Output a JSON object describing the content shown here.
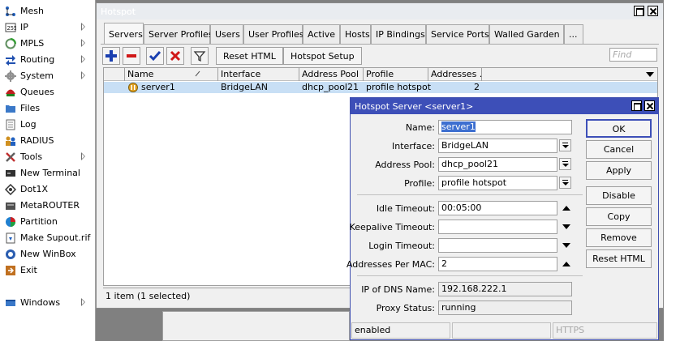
{
  "sidebar": {
    "items": [
      {
        "label": "Mesh",
        "icon": "mesh-icon",
        "submenu": false
      },
      {
        "label": "IP",
        "icon": "ip-icon",
        "submenu": true
      },
      {
        "label": "MPLS",
        "icon": "mpls-icon",
        "submenu": true
      },
      {
        "label": "Routing",
        "icon": "routing-icon",
        "submenu": true
      },
      {
        "label": "System",
        "icon": "system-gear-icon",
        "submenu": true
      },
      {
        "label": "Queues",
        "icon": "queues-icon",
        "submenu": false
      },
      {
        "label": "Files",
        "icon": "folder-icon",
        "submenu": false
      },
      {
        "label": "Log",
        "icon": "log-icon",
        "submenu": false
      },
      {
        "label": "RADIUS",
        "icon": "radius-users-icon",
        "submenu": false
      },
      {
        "label": "Tools",
        "icon": "tools-icon",
        "submenu": true
      },
      {
        "label": "New Terminal",
        "icon": "terminal-icon",
        "submenu": false
      },
      {
        "label": "Dot1X",
        "icon": "dot1x-icon",
        "submenu": false
      },
      {
        "label": "MetaROUTER",
        "icon": "metarouter-icon",
        "submenu": false
      },
      {
        "label": "Partition",
        "icon": "partition-pie-icon",
        "submenu": false
      },
      {
        "label": "Make Supout.rif",
        "icon": "supout-icon",
        "submenu": false
      },
      {
        "label": "New WinBox",
        "icon": "winbox-icon",
        "submenu": false
      },
      {
        "label": "Exit",
        "icon": "exit-icon",
        "submenu": false
      },
      {
        "label": "Windows",
        "icon": "windows-icon",
        "submenu": true
      }
    ]
  },
  "hotspot": {
    "title": "Hotspot",
    "tabs": [
      "Servers",
      "Server Profiles",
      "Users",
      "User Profiles",
      "Active",
      "Hosts",
      "IP Bindings",
      "Service Ports",
      "Walled Garden",
      "..."
    ],
    "toolbar": {
      "reset_html": "Reset HTML",
      "hotspot_setup": "Hotspot Setup",
      "find_placeholder": "Find"
    },
    "columns": [
      "Name",
      "Interface",
      "Address Pool",
      "Profile",
      "Addresses ..."
    ],
    "rows": [
      {
        "name": "server1",
        "interface": "BridgeLAN",
        "address_pool": "dhcp_pool21",
        "profile": "profile hotspot",
        "addresses": "2"
      }
    ],
    "status": "1 item (1 selected)"
  },
  "dialog": {
    "title": "Hotspot Server <server1>",
    "labels": {
      "name": "Name:",
      "interface": "Interface:",
      "address_pool": "Address Pool:",
      "profile": "Profile:",
      "idle_timeout": "Idle Timeout:",
      "keepalive_timeout": "Keepalive Timeout:",
      "login_timeout": "Login Timeout:",
      "addresses_per_mac": "Addresses Per MAC:",
      "ip_of_dns_name": "IP of DNS Name:",
      "proxy_status": "Proxy Status:"
    },
    "values": {
      "name": "server1",
      "interface": "BridgeLAN",
      "address_pool": "dhcp_pool21",
      "profile": "profile hotspot",
      "idle_timeout": "00:05:00",
      "keepalive_timeout": "",
      "login_timeout": "",
      "addresses_per_mac": "2",
      "ip_of_dns_name": "192.168.222.1",
      "proxy_status": "running"
    },
    "buttons": {
      "ok": "OK",
      "cancel": "Cancel",
      "apply": "Apply",
      "disable": "Disable",
      "copy": "Copy",
      "remove": "Remove",
      "reset_html": "Reset HTML"
    },
    "status": {
      "state": "enabled",
      "middle": "",
      "protocol": "HTTPS"
    }
  },
  "colors": {
    "selection": "#c8dff5",
    "dialog_title": "#3d4fb8",
    "accent_blue": "#1a3fb0",
    "delete_red": "#d01818"
  }
}
